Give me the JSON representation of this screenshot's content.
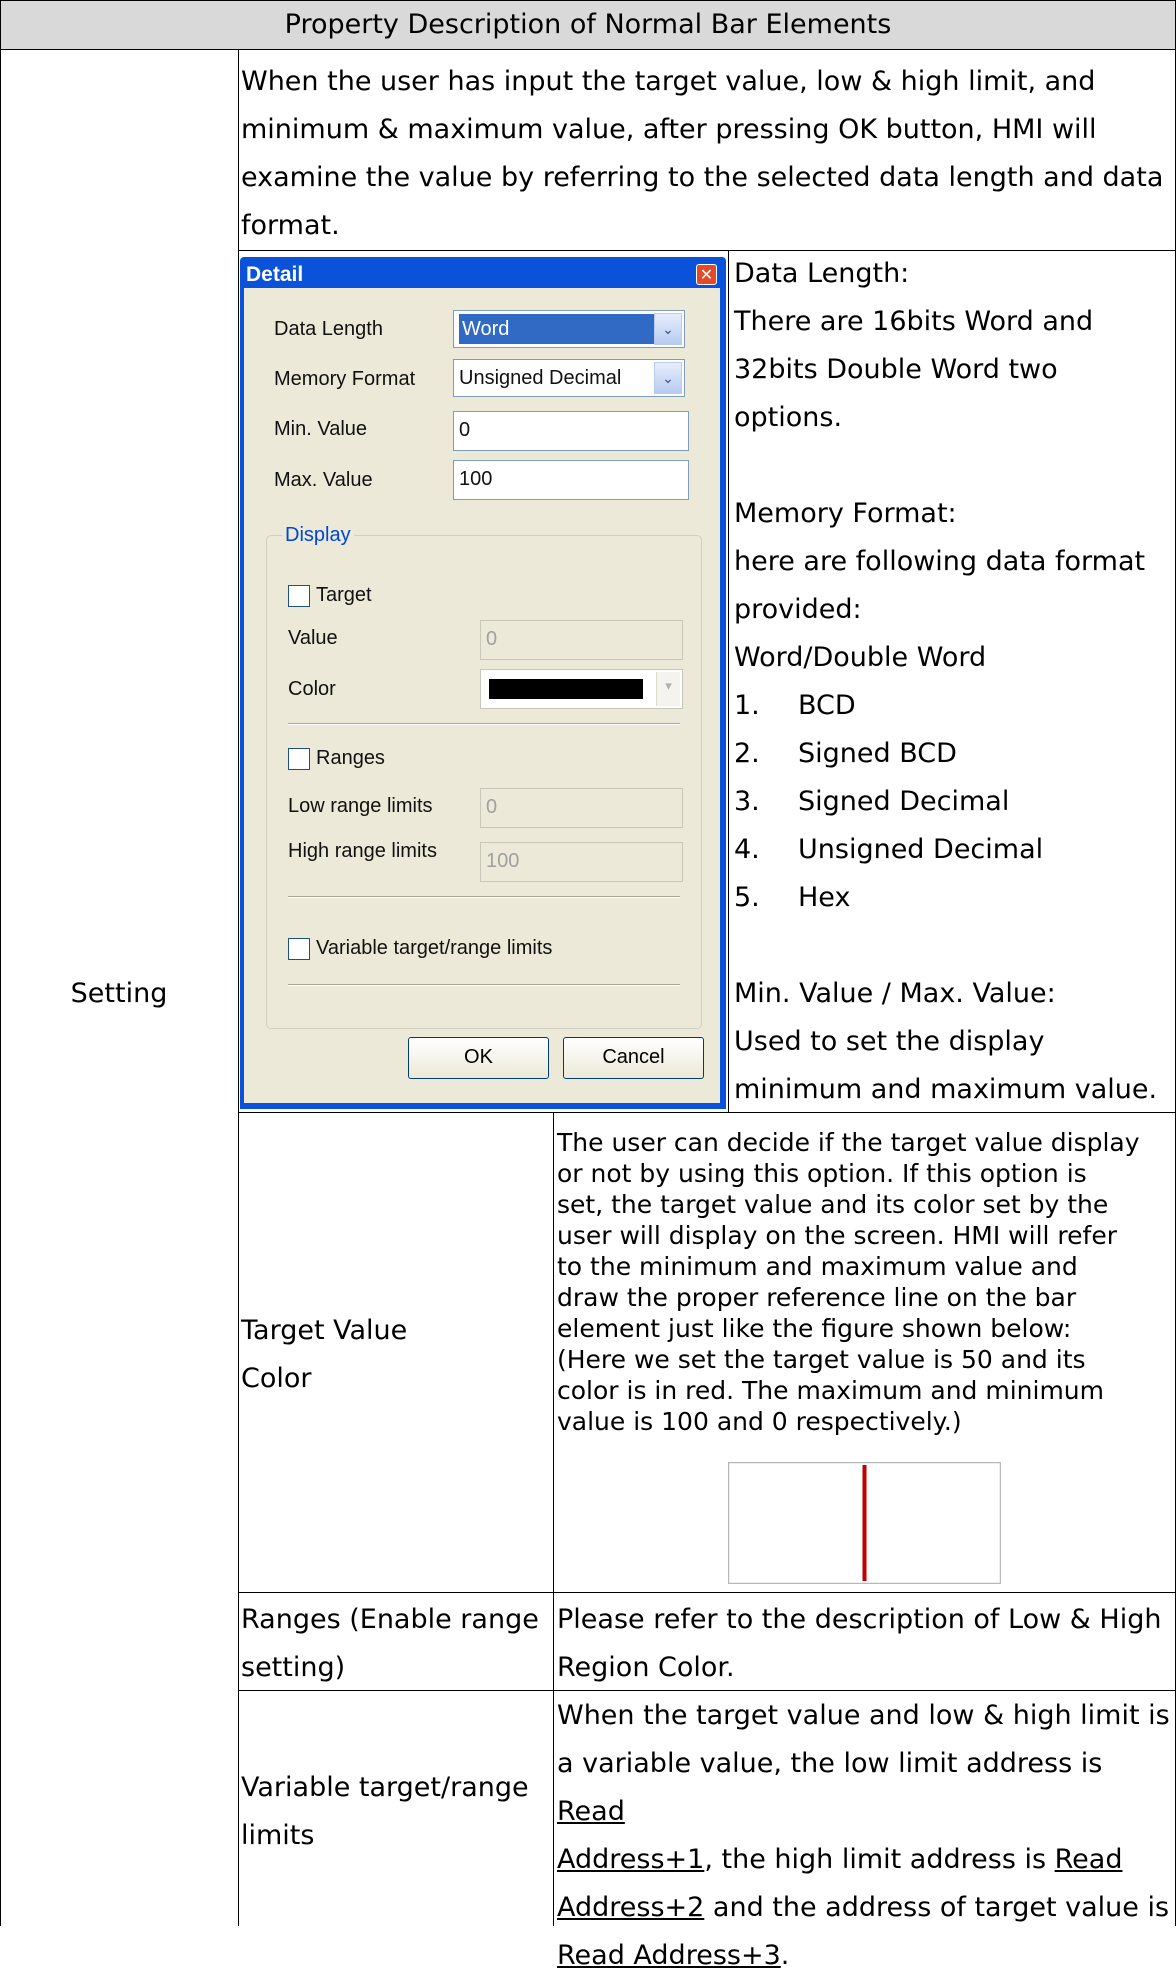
{
  "header": {
    "title": "Property Description of Normal Bar Elements"
  },
  "section_label": "Setting",
  "intro_text": [
    "When the user has input the target value, low & high limit, and",
    "minimum & maximum value, after pressing OK button, HMI will",
    "examine the value by referring to the selected data length and data",
    "format."
  ],
  "dialog": {
    "title": "Detail",
    "data_length_label": "Data Length",
    "data_length_value": "Word",
    "memory_format_label": "Memory Format",
    "memory_format_value": "Unsigned Decimal",
    "min_label": "Min. Value",
    "min_value": "0",
    "max_label": "Max. Value",
    "max_value": "100",
    "display_group": "Display",
    "target_label": "Target",
    "value_label": "Value",
    "value_value": "0",
    "color_label": "Color",
    "color_value": "#000000",
    "ranges_label": "Ranges",
    "low_range_label": "Low range limits",
    "low_range_value": "0",
    "high_range_label": "High range limits",
    "high_range_value": "100",
    "variable_label": "Variable target/range limits",
    "ok_label": "OK",
    "cancel_label": "Cancel"
  },
  "side_notes": {
    "data_length_heading": "Data Length:",
    "data_length_desc": [
      "There are 16bits Word and",
      "32bits Double Word two",
      "options."
    ],
    "memory_format_heading": "Memory Format:",
    "memory_format_desc": [
      "here are following data format",
      "provided:"
    ],
    "formats_group": "Word/Double Word",
    "formats": [
      {
        "num": "1.",
        "name": "BCD"
      },
      {
        "num": "2.",
        "name": "Signed BCD"
      },
      {
        "num": "3.",
        "name": "Signed Decimal"
      },
      {
        "num": "4.",
        "name": "Unsigned Decimal"
      },
      {
        "num": "5.",
        "name": "Hex"
      }
    ],
    "minmax_heading": "Min. Value / Max. Value:",
    "minmax_desc": [
      "Used to set the display",
      "minimum and maximum value."
    ]
  },
  "rows": {
    "target": {
      "label": [
        "Target Value",
        "Color"
      ],
      "desc": [
        "The user can decide if the target value display",
        "or not by using this option. If this option is",
        "set, the target value and its color set by the",
        "user will display on the screen. HMI will refer",
        "to the minimum and maximum value and",
        "draw the proper reference line on the bar",
        "element just like the figure shown below:",
        "(Here we set the target value is 50 and its",
        "color is in red. The maximum and minimum",
        "value is 100 and 0 respectively.)"
      ],
      "example": {
        "min": 0,
        "max": 100,
        "target": 50,
        "line_color": "#c00000"
      }
    },
    "ranges": {
      "label": [
        "Ranges (Enable range",
        "setting)"
      ],
      "desc": [
        "Please refer to the description of Low & High",
        "Region Color."
      ]
    },
    "variable": {
      "label": [
        "Variable target/range",
        "limits"
      ],
      "desc_line1": "When the target value and low & high limit is",
      "desc_line2_pre": "a variable value, the low limit address is ",
      "desc_line2_link": "Read",
      "desc_line3_link": "Address+1",
      "desc_line3_mid": ", the high limit address is ",
      "desc_line3_link2": "Read ",
      "desc_line4_link": "Address+2",
      "desc_line4_post": " and the address of target value is",
      "desc_line5_link": "Read Address+3",
      "desc_line5_post": "."
    }
  }
}
